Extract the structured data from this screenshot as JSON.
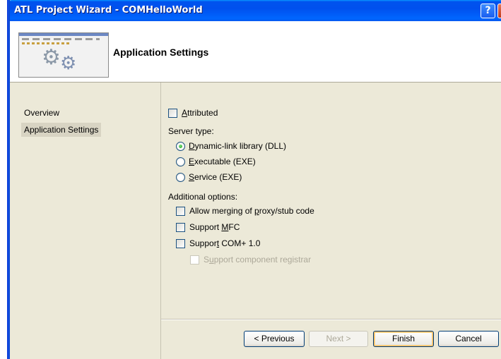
{
  "window": {
    "title": "ATL Project Wizard - COMHelloWorld",
    "help_glyph": "?",
    "close_glyph": "✕"
  },
  "header": {
    "title": "Application Settings",
    "icon": "gears-icon"
  },
  "nav": {
    "items": [
      {
        "label": "Overview",
        "selected": false
      },
      {
        "label": "Application Settings",
        "selected": true
      }
    ]
  },
  "main": {
    "attributed": {
      "label_pre": "",
      "label_key": "A",
      "label_post": "ttributed",
      "checked": false
    },
    "server_type": {
      "label": "Server type:",
      "options": [
        {
          "pre": "",
          "key": "D",
          "post": "ynamic-link library (DLL)",
          "selected": true
        },
        {
          "pre": "",
          "key": "E",
          "post": "xecutable (EXE)",
          "selected": false
        },
        {
          "pre": "",
          "key": "S",
          "post": "ervice (EXE)",
          "selected": false
        }
      ]
    },
    "additional_options": {
      "label": "Additional options:",
      "items": [
        {
          "pre": "Allow merging of ",
          "key": "p",
          "post": "roxy/stub code",
          "checked": false,
          "enabled": true
        },
        {
          "pre": "Support ",
          "key": "M",
          "post": "FC",
          "checked": false,
          "enabled": true
        },
        {
          "pre": "Suppor",
          "key": "t",
          "post": " COM+ 1.0",
          "checked": false,
          "enabled": true
        },
        {
          "pre": "S",
          "key": "u",
          "post": "pport component registrar",
          "checked": false,
          "enabled": false
        }
      ]
    }
  },
  "footer": {
    "previous": "< Previous",
    "next": "Next >",
    "finish": "Finish",
    "cancel": "Cancel"
  },
  "colors": {
    "titlebar": "#0053ee",
    "dialog_bg": "#ece9d8",
    "button_border": "#003c74",
    "disabled_text": "#aca899"
  }
}
